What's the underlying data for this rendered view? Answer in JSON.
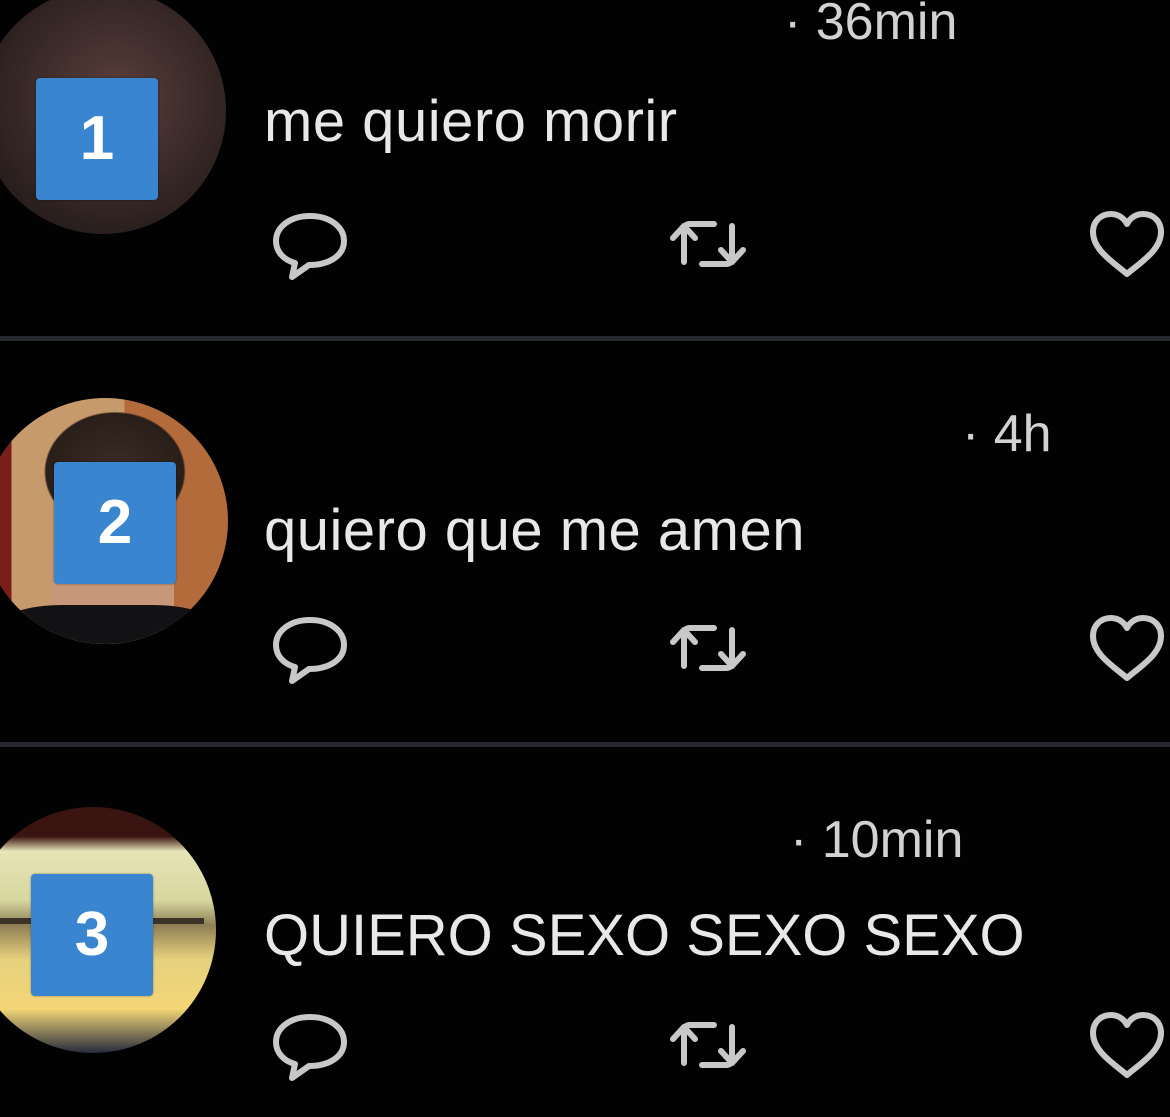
{
  "feed": {
    "tweets": [
      {
        "badge": "1",
        "timestamp": "· 36min",
        "text": "me quiero morir"
      },
      {
        "badge": "2",
        "timestamp": "· 4h",
        "text": "quiero que me amen"
      },
      {
        "badge": "3",
        "timestamp": "· 10min",
        "text": "QUIERO SEXO SEXO SEXO"
      }
    ],
    "icons": {
      "reply": "reply-icon",
      "retweet": "retweet-icon",
      "like": "like-icon"
    },
    "colors": {
      "background": "#020203",
      "divider": "#262a30",
      "badge": "#3a85cf",
      "text": "#e8e8e8",
      "icon": "#c8c8c8"
    }
  }
}
